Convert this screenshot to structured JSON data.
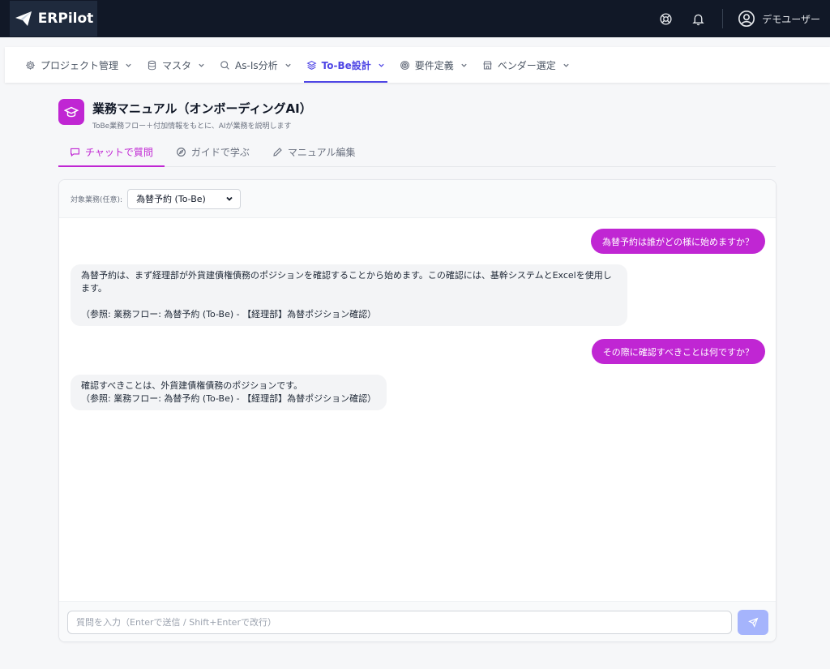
{
  "topbar": {
    "brand": "ERPilot",
    "user_name": "デモユーザー",
    "bg_color": "#111827"
  },
  "nav": {
    "items": [
      {
        "label": "プロジェクト管理",
        "icon": "gear-icon"
      },
      {
        "label": "マスタ",
        "icon": "database-icon"
      },
      {
        "label": "As-Is分析",
        "icon": "search-icon"
      },
      {
        "label": "To-Be設計",
        "icon": "layers-icon",
        "active": true
      },
      {
        "label": "要件定義",
        "icon": "target-icon"
      },
      {
        "label": "ベンダー選定",
        "icon": "store-icon"
      }
    ]
  },
  "page": {
    "title": "業務マニュアル（オンボーディングAI）",
    "subtitle": "ToBe業務フロー＋付加情報をもとに、AIが業務を説明します"
  },
  "tabs": [
    {
      "label": "チャットで質問",
      "icon": "chat-icon",
      "active": true
    },
    {
      "label": "ガイドで学ぶ",
      "icon": "compass-icon"
    },
    {
      "label": "マニュアル編集",
      "icon": "pencil-icon"
    }
  ],
  "chat": {
    "filter_label": "対象業務(任意):",
    "filter_value": "為替予約 (To-Be)",
    "messages": [
      {
        "role": "user",
        "text": "為替予約は誰がどの様に始めますか？"
      },
      {
        "role": "ai",
        "text": "為替予約は、まず経理部が外貨建債権債務のポジションを確認することから始めます。この確認には、基幹システムとExcelを使用し\nます。\n\n（参照: 業務フロー: 為替予約 (To-Be) - 【経理部】為替ポジション確認）"
      },
      {
        "role": "user",
        "text": "その際に確認すべきことは何ですか？"
      },
      {
        "role": "ai",
        "text": "確認すべきことは、外貨建債権債務のポジションです。\n（参照: 業務フロー: 為替予約 (To-Be) - 【経理部】為替ポジション確認）"
      }
    ],
    "input_placeholder": "質問を入力（Enterで送信 / Shift+Enterで改行）",
    "accent_color": "#c026d3"
  }
}
